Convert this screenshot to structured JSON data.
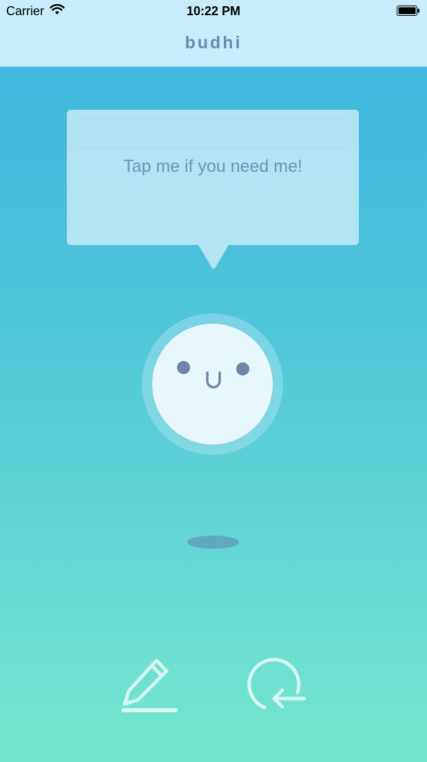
{
  "status_bar": {
    "carrier": "Carrier",
    "time": "10:22 PM",
    "wifi_icon": "wifi-icon",
    "battery_icon": "battery-icon"
  },
  "nav": {
    "title": "budhi"
  },
  "bubble": {
    "text": "Tap me if you need me!"
  },
  "face": {
    "expression": "smile",
    "eye_color": "#6c85a9",
    "face_color": "#e8f7fb"
  },
  "toolbar": {
    "left_icon": "pencil-icon",
    "right_icon": "rotate-back-icon",
    "icon_color": "#d5f8f1"
  },
  "colors": {
    "gradient_top": "#3db3e1",
    "gradient_bottom": "#76e6cc",
    "bar_background": "#c8ecf9",
    "title_color": "#6b88ad",
    "bubble_text": "#6e92b6"
  }
}
